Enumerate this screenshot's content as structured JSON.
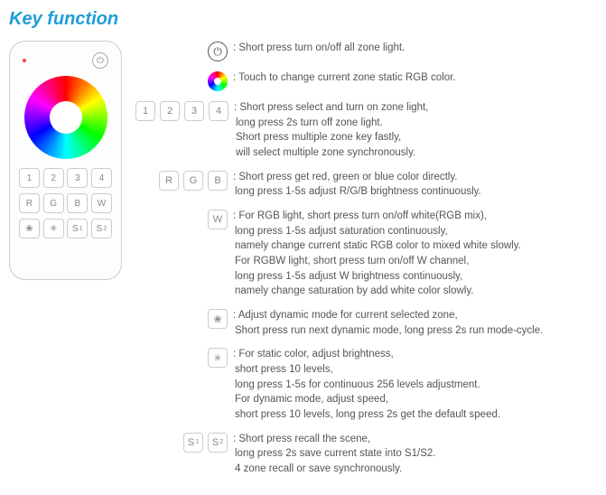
{
  "title": "Key function",
  "remote": {
    "zones": [
      "1",
      "2",
      "3",
      "4"
    ],
    "rgb": [
      "R",
      "G",
      "B",
      "W"
    ],
    "s1": "S",
    "s1n": "1",
    "s2": "S",
    "s2n": "2"
  },
  "rows": {
    "power": "Short press turn on/off all zone light.",
    "rgb": "Touch to change current zone static RGB color.",
    "zones": "Short press select and turn on zone light,\nlong press 2s turn off zone light.\nShort press multiple zone key fastly,\nwill select multiple zone synchronously.",
    "rgbbtn": "Short press get red, green or blue color directly.\nlong press 1-5s adjust R/G/B brightness continuously.",
    "w": "For RGB light, short press turn on/off white(RGB mix),\nlong press 1-5s adjust saturation continuously,\nnamely change current static RGB color to mixed white slowly.\nFor RGBW light, short press turn on/off W channel,\nlong press 1-5s adjust W brightness continuously,\nnamely change saturation by add white color slowly.",
    "mode": "Adjust dynamic mode for current selected zone,\nShort press run next dynamic mode, long press 2s run mode-cycle.",
    "bright": "For static color, adjust brightness,\nshort press 10 levels,\nlong press 1-5s for continuous 256 levels adjustment.\nFor dynamic mode, adjust speed,\nshort press 10 levels, long press 2s get the default speed.",
    "scene": "Short press recall the scene,\nlong press 2s save current state into S1/S2.\n4 zone recall or save synchronously."
  },
  "btns": {
    "z1": "1",
    "z2": "2",
    "z3": "3",
    "z4": "4",
    "r": "R",
    "g": "G",
    "b": "B",
    "w": "W",
    "mode": "❀",
    "bright": "✳",
    "s1a": "S",
    "s1b": "1",
    "s2a": "S",
    "s2b": "2"
  }
}
